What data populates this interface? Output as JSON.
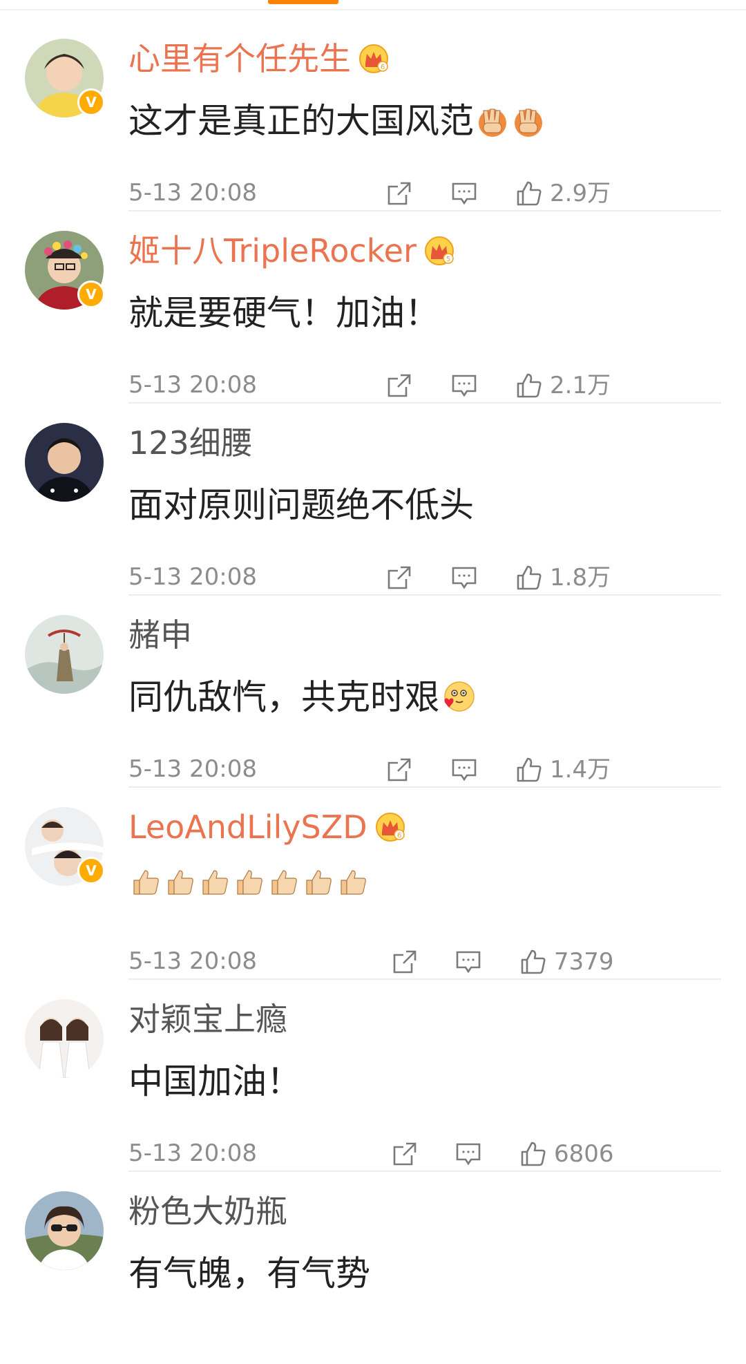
{
  "colors": {
    "accent": "#ff8200",
    "vip_name": "#eb7350",
    "verified": "#ffab00",
    "meta_text": "#8c8c8c"
  },
  "comments": [
    {
      "username": "心里有个任先生",
      "vip": true,
      "verified": true,
      "text": "这才是真正的大国风范",
      "emoji": [
        "hands-icon",
        "hands-icon"
      ],
      "time": "5-13 20:08",
      "likes": "2.9万"
    },
    {
      "username": "姬十八TripleRocker",
      "vip": true,
      "verified": true,
      "text": "就是要硬气！加油！",
      "emoji": [],
      "time": "5-13 20:08",
      "likes": "2.1万"
    },
    {
      "username": "123细腰",
      "vip": false,
      "verified": false,
      "text": "面对原则问题绝不低头",
      "emoji": [],
      "time": "5-13 20:08",
      "likes": "1.8万"
    },
    {
      "username": "赭申",
      "vip": false,
      "verified": false,
      "text": "同仇敌忾，共克时艰",
      "emoji": [
        "heart-face-icon"
      ],
      "time": "5-13 20:08",
      "likes": "1.4万"
    },
    {
      "username": "LeoAndLilySZD",
      "vip": true,
      "verified": true,
      "text": "",
      "emoji": [
        "thumbs-up-icon",
        "thumbs-up-icon",
        "thumbs-up-icon",
        "thumbs-up-icon",
        "thumbs-up-icon",
        "thumbs-up-icon",
        "thumbs-up-icon"
      ],
      "time": "5-13 20:08",
      "likes": "7379"
    },
    {
      "username": "对颖宝上瘾",
      "vip": false,
      "verified": false,
      "text": "中国加油！",
      "emoji": [],
      "time": "5-13 20:08",
      "likes": "6806"
    },
    {
      "username": "粉色大奶瓶",
      "vip": false,
      "verified": false,
      "text": "有气魄，有气势",
      "emoji": [],
      "time": "",
      "likes": ""
    }
  ]
}
